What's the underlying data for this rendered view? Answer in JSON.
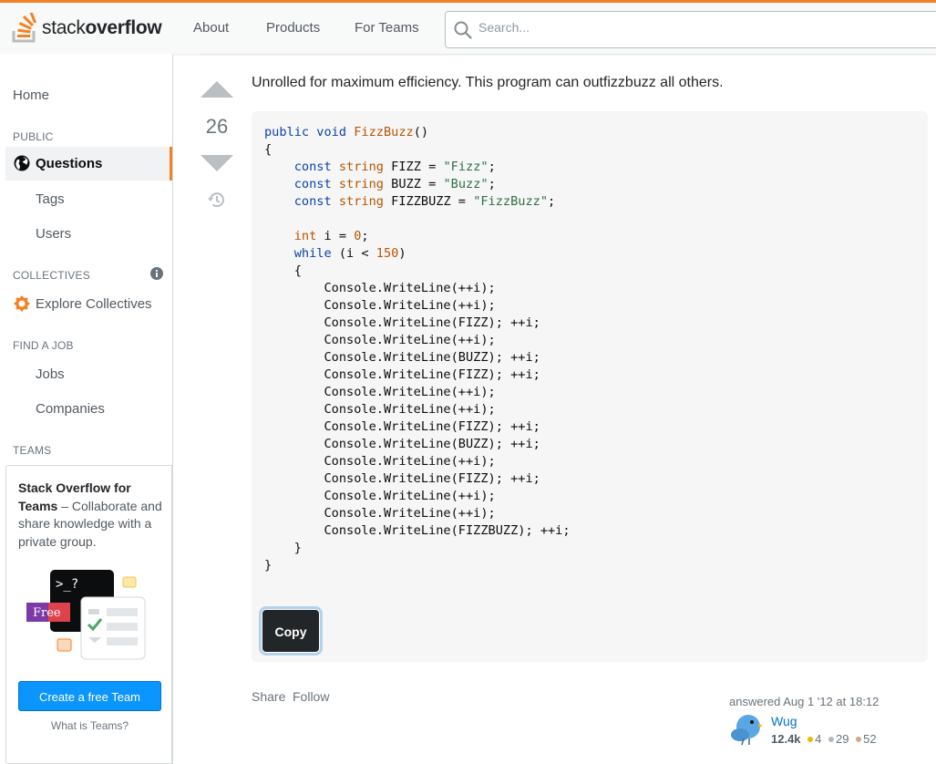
{
  "header": {
    "logo_plain": "stack",
    "logo_bold": "overflow",
    "nav": [
      "About",
      "Products",
      "For Teams"
    ],
    "search_placeholder": "Search..."
  },
  "sidebar": {
    "home": "Home",
    "public_heading": "PUBLIC",
    "questions": "Questions",
    "tags": "Tags",
    "users": "Users",
    "collectives_heading": "COLLECTIVES",
    "explore_collectives": "Explore Collectives",
    "find_job_heading": "FIND A JOB",
    "jobs": "Jobs",
    "companies": "Companies",
    "teams_heading": "TEAMS",
    "teams_title": "Stack Overflow for Teams",
    "teams_desc": " – Collaborate and share knowledge with a private group.",
    "illus_prompt": ">_?",
    "illus_free": "Free",
    "create_team": "Create a free Team",
    "what_is_teams": "What is Teams?"
  },
  "answer": {
    "score": "26",
    "intro": "Unrolled for maximum efficiency. This program can outfizzbuzz all others.",
    "copy_label": "Copy",
    "share": "Share",
    "follow": "Follow",
    "answered": "answered Aug 1 '12 at 18:12",
    "user_name": "Wug",
    "user_rep": "12.4k",
    "gold": "4",
    "silver": "29",
    "bronze": "52"
  },
  "colors": {
    "brand_orange": "#f48225",
    "link_blue": "#0074cc",
    "button_blue": "#0a95ff",
    "gold": "#f1b600",
    "silver": "#b4b8bc",
    "bronze": "#d1a684"
  },
  "icons": [
    "stack-overflow-logo-icon",
    "search-icon",
    "globe-icon",
    "info-icon",
    "collectives-icon",
    "vote-up-icon",
    "vote-down-icon",
    "history-icon",
    "user-avatar"
  ]
}
